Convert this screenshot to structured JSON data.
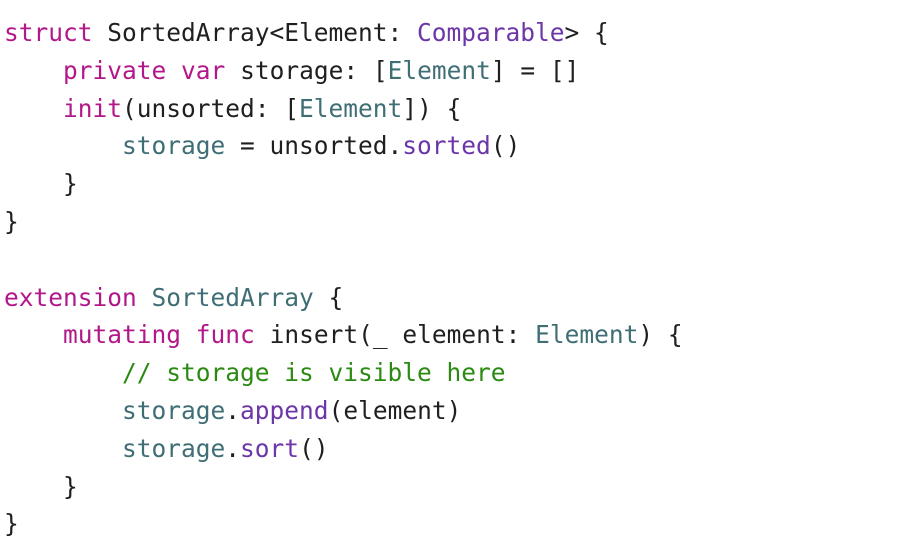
{
  "code_editor": {
    "colors": {
      "keyword": "#b21889",
      "type": "#3f6e74",
      "project_symbol": "#6c36a9",
      "comment": "#2b8a12",
      "plain": "#1f1f1f",
      "background": "#ffffff"
    },
    "lines": [
      [
        {
          "kind": "kw",
          "text": "struct"
        },
        {
          "kind": "pl",
          "text": " SortedArray<Element: "
        },
        {
          "kind": "pr",
          "text": "Comparable"
        },
        {
          "kind": "pl",
          "text": "> {"
        }
      ],
      [
        {
          "kind": "pl",
          "text": "    "
        },
        {
          "kind": "kw",
          "text": "private"
        },
        {
          "kind": "pl",
          "text": " "
        },
        {
          "kind": "kw",
          "text": "var"
        },
        {
          "kind": "pl",
          "text": " storage: ["
        },
        {
          "kind": "ty",
          "text": "Element"
        },
        {
          "kind": "pl",
          "text": "] = []"
        }
      ],
      [
        {
          "kind": "pl",
          "text": "    "
        },
        {
          "kind": "kw",
          "text": "init"
        },
        {
          "kind": "pl",
          "text": "(unsorted: ["
        },
        {
          "kind": "ty",
          "text": "Element"
        },
        {
          "kind": "pl",
          "text": "]) {"
        }
      ],
      [
        {
          "kind": "pl",
          "text": "        "
        },
        {
          "kind": "ty",
          "text": "storage"
        },
        {
          "kind": "pl",
          "text": " = unsorted."
        },
        {
          "kind": "pr",
          "text": "sorted"
        },
        {
          "kind": "pl",
          "text": "()"
        }
      ],
      [
        {
          "kind": "pl",
          "text": "    }"
        }
      ],
      [
        {
          "kind": "pl",
          "text": "}"
        }
      ],
      [],
      [
        {
          "kind": "kw",
          "text": "extension"
        },
        {
          "kind": "pl",
          "text": " "
        },
        {
          "kind": "ty",
          "text": "SortedArray"
        },
        {
          "kind": "pl",
          "text": " {"
        }
      ],
      [
        {
          "kind": "pl",
          "text": "    "
        },
        {
          "kind": "kw",
          "text": "mutating"
        },
        {
          "kind": "pl",
          "text": " "
        },
        {
          "kind": "kw",
          "text": "func"
        },
        {
          "kind": "pl",
          "text": " insert(_ element: "
        },
        {
          "kind": "ty",
          "text": "Element"
        },
        {
          "kind": "pl",
          "text": ") {"
        }
      ],
      [
        {
          "kind": "pl",
          "text": "        "
        },
        {
          "kind": "cm",
          "text": "// storage is visible here"
        }
      ],
      [
        {
          "kind": "pl",
          "text": "        "
        },
        {
          "kind": "ty",
          "text": "storage"
        },
        {
          "kind": "pl",
          "text": "."
        },
        {
          "kind": "pr",
          "text": "append"
        },
        {
          "kind": "pl",
          "text": "(element)"
        }
      ],
      [
        {
          "kind": "pl",
          "text": "        "
        },
        {
          "kind": "ty",
          "text": "storage"
        },
        {
          "kind": "pl",
          "text": "."
        },
        {
          "kind": "pr",
          "text": "sort"
        },
        {
          "kind": "pl",
          "text": "()"
        }
      ],
      [
        {
          "kind": "pl",
          "text": "    }"
        }
      ],
      [
        {
          "kind": "pl",
          "text": "}"
        }
      ]
    ]
  }
}
